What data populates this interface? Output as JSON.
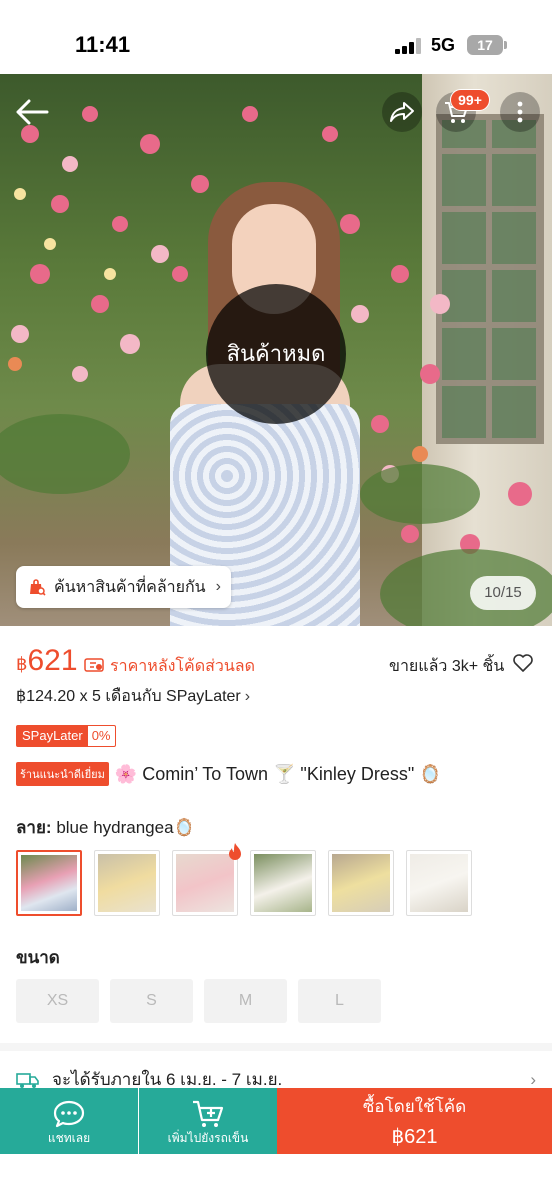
{
  "status_bar": {
    "time": "11:41",
    "network": "5G",
    "battery": "17"
  },
  "header": {
    "cart_badge": "99+"
  },
  "hero": {
    "overlay_text": "สินค้าหมด",
    "similar_button": "ค้นหาสินค้าที่คล้ายกัน",
    "image_counter": "10/15"
  },
  "price": {
    "currency": "฿",
    "amount": "621",
    "note": "ราคาหลังโค้ดส่วนลด",
    "sold": "ขายแล้ว 3k+ ชิ้น",
    "installment": "฿124.20 x 5 เดือนกับ SPayLater"
  },
  "spaylater": {
    "label": "SPayLater",
    "rate": "0%"
  },
  "product": {
    "badge": "ร้านแนะนำดีเยี่ยม",
    "title": "🌸 Comin’ To Town 🍸 \"Kinley Dress\" 🪞"
  },
  "variant": {
    "label": "ลาย:",
    "value": "blue hydrangea🪞",
    "thumbnail_count": 6
  },
  "size": {
    "label": "ขนาด",
    "options": [
      "XS",
      "S",
      "M",
      "L"
    ]
  },
  "delivery": {
    "text": "จะได้รับภายใน 6 เม.ย. - 7 เม.ย."
  },
  "bottom_bar": {
    "chat": "แชทเลย",
    "add_to_cart": "เพิ่มไปยังรถเข็น",
    "buy_line1": "ซื้อโดยใช้โค้ด",
    "buy_line2": "฿621"
  },
  "colors": {
    "accent": "#ee4d2d",
    "teal": "#26aa99"
  }
}
